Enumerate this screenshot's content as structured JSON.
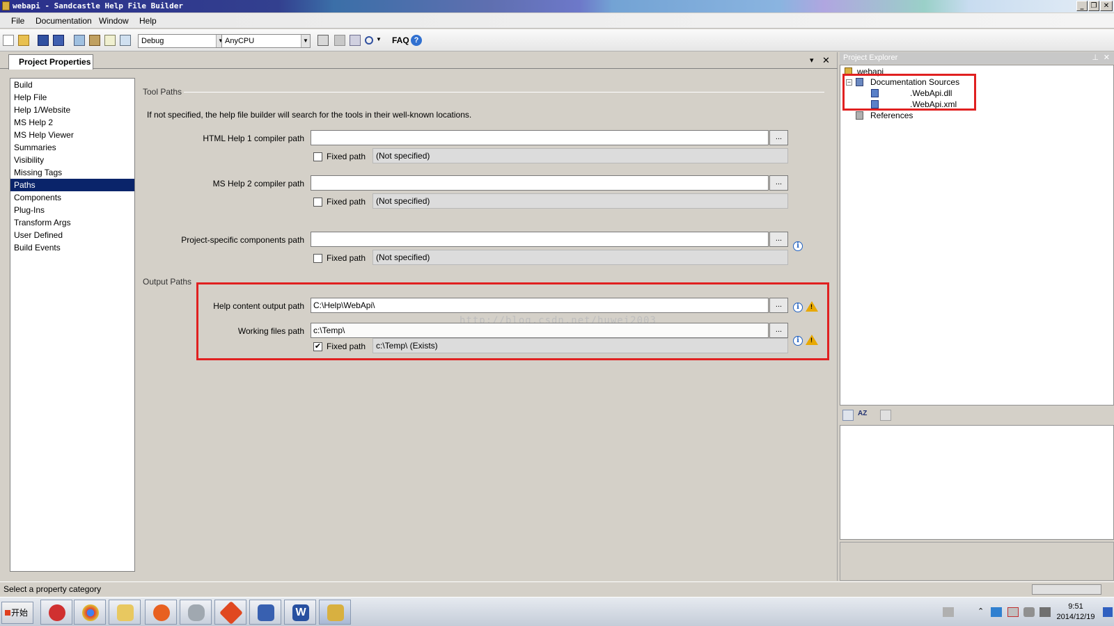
{
  "window": {
    "title": "webapi - Sandcastle Help File Builder"
  },
  "menu": [
    "File",
    "Documentation",
    "Window",
    "Help"
  ],
  "toolbar": {
    "config": "Debug",
    "platform": "AnyCPU",
    "faq": "FAQ",
    "icons": [
      "new-project-icon",
      "open-project-icon",
      "save-icon",
      "save-all-icon",
      "build-icon",
      "clean-icon",
      "view-log-icon",
      "view-help-icon",
      "build-window-icon",
      "cancel-build-icon",
      "properties-icon",
      "search-icon",
      "help-icon"
    ]
  },
  "doc_tab": {
    "label": "Project Properties",
    "close": "✕",
    "dropdown": "▾"
  },
  "categories": [
    "Build",
    "Help File",
    "Help 1/Website",
    "MS Help 2",
    "MS Help Viewer",
    "Summaries",
    "Visibility",
    "Missing Tags",
    "Paths",
    "Components",
    "Plug-Ins",
    "Transform Args",
    "User Defined",
    "Build Events"
  ],
  "selected_category": "Paths",
  "tool_paths": {
    "group_label": "Tool Paths",
    "note": "If not specified, the help file builder will search for the tools in their well-known locations.",
    "fields": [
      {
        "label": "HTML Help 1 compiler path",
        "value": "",
        "fixed_label": "Fixed path",
        "fixed_checked": false,
        "resolved": "(Not specified)"
      },
      {
        "label": "MS Help 2 compiler path",
        "value": "",
        "fixed_label": "Fixed path",
        "fixed_checked": false,
        "resolved": "(Not specified)"
      },
      {
        "label": "Project-specific components path",
        "value": "",
        "fixed_label": "Fixed path",
        "fixed_checked": false,
        "resolved": "(Not specified)"
      }
    ]
  },
  "output_paths": {
    "group_label": "Output Paths",
    "help_content": {
      "label": "Help content output path",
      "value": "C:\\Help\\WebApi\\"
    },
    "working": {
      "label": "Working files path",
      "value": "c:\\Temp\\",
      "fixed_label": "Fixed path",
      "fixed_checked": true,
      "resolved": "c:\\Temp\\ (Exists)"
    }
  },
  "browse_label": "...",
  "info_glyph": "i",
  "warn_glyph": "!",
  "check_glyph": "✔",
  "watermark": "http://blog.csdn.net/huwei2003",
  "explorer": {
    "title": "Project Explorer",
    "root": "webapi",
    "doc_sources": "Documentation Sources",
    "files": [
      ".WebApi.dll",
      ".WebApi.xml"
    ],
    "references": "References",
    "pin": "⊥",
    "close": "✕"
  },
  "status": {
    "text": "Select a property category"
  },
  "taskbar": {
    "start": "开始",
    "apps": [
      "snipping-tool",
      "chrome",
      "file-explorer",
      "media-player",
      "database-tool",
      "git",
      "remote-desktop",
      "word",
      "sandcastle"
    ],
    "clock_time": "9:51",
    "clock_date": "2014/12/19"
  },
  "colors": {
    "selection": "#0a246a",
    "highlight_box": "#e02020",
    "info": "#2060c0",
    "warning": "#e8a800"
  }
}
